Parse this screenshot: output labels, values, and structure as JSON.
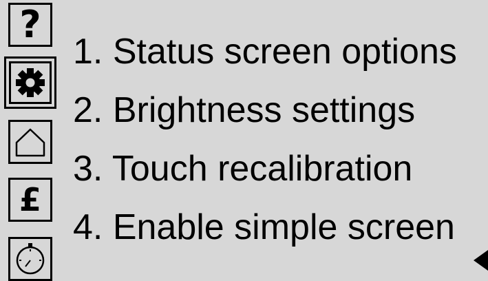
{
  "sidebar": {
    "buttons": [
      {
        "name": "help-icon",
        "glyph": "?"
      },
      {
        "name": "gear-icon",
        "selected": true
      },
      {
        "name": "home-icon"
      },
      {
        "name": "pound-icon",
        "glyph": "£"
      },
      {
        "name": "stopwatch-icon"
      }
    ]
  },
  "menu": {
    "items": [
      {
        "label": "1. Status screen options"
      },
      {
        "label": "2. Brightness settings"
      },
      {
        "label": "3. Touch recalibration"
      },
      {
        "label": "4. Enable simple screen"
      }
    ]
  },
  "nav": {
    "back_arrow_icon": "left-arrow-icon"
  }
}
